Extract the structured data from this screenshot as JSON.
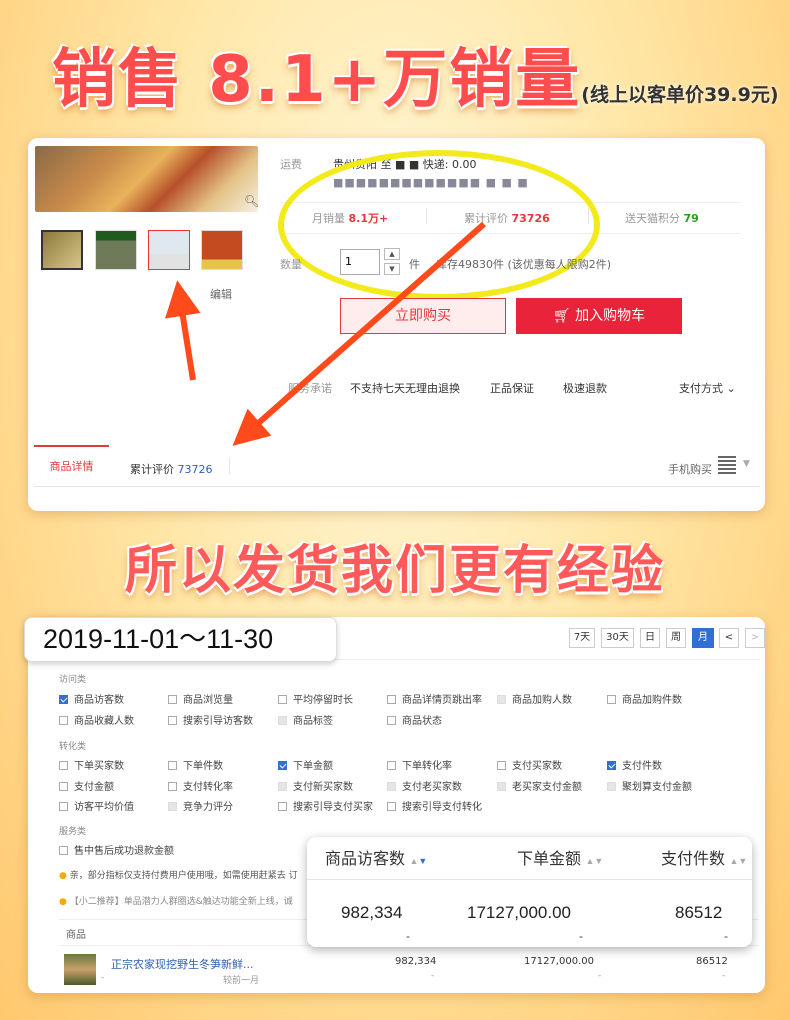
{
  "headline1": {
    "main": "销售 8.1+万销量",
    "sub": "(线上以客单价39.9元)"
  },
  "headline2": "所以发货我们更有经验",
  "product_card": {
    "shipping_label": "运费",
    "shipping_value": "贵州贵阳 至 ■ ■ 快递: 0.00",
    "shipping_blur": "■■■■■■■■■■■■■ ■ ■ ■",
    "monthly_sales_label": "月销量",
    "monthly_sales_value": "8.1万+",
    "total_reviews_label": "累计评价",
    "total_reviews_value": "73726",
    "points_label": "送天猫积分",
    "points_value": "79",
    "quantity_label": "数量",
    "quantity_value": "1",
    "quantity_unit": "件",
    "stock_text": "库存49830件 (该优惠每人限购2件)",
    "edit_label": "编辑",
    "buy_now": "立即购买",
    "add_to_cart": "加入购物车",
    "promise_label": "服务承诺",
    "promises": [
      "不支持七天无理由退换",
      "正品保证",
      "极速退款"
    ],
    "payment_label": "支付方式",
    "tabs": {
      "detail": "商品详情",
      "reviews_label": "累计评价",
      "reviews_value": "73726"
    },
    "mobile_buy": "手机购买"
  },
  "stats_card": {
    "date_range": "2019-11-01～11-30",
    "periods": [
      {
        "label": "7天",
        "active": false
      },
      {
        "label": "30天",
        "active": false
      },
      {
        "label": "日",
        "active": false
      },
      {
        "label": "周",
        "active": false
      },
      {
        "label": "月",
        "active": true
      }
    ],
    "prev": "<",
    "next": ">",
    "sections": {
      "traffic": {
        "title": "访问类",
        "rows": [
          [
            "商品访客数",
            "商品浏览量",
            "平均停留时长",
            "商品详情页跳出率",
            "商品加购人数",
            "商品加购件数"
          ],
          [
            "商品收藏人数",
            "搜索引导访客数",
            "商品标签",
            "商品状态"
          ]
        ]
      },
      "conversion": {
        "title": "转化类",
        "rows": [
          [
            "下单买家数",
            "下单件数",
            "下单金额",
            "下单转化率",
            "支付买家数",
            "支付件数"
          ],
          [
            "支付金额",
            "支付转化率",
            "支付新买家数",
            "支付老买家数",
            "老买家支付金额",
            "聚划算支付金额"
          ],
          [
            "访客平均价值",
            "竞争力评分",
            "搜索引导支付买家",
            "搜索引导支付转化"
          ]
        ]
      },
      "service": {
        "title": "服务类",
        "rows": [
          [
            "售中售后成功退款金额"
          ]
        ]
      }
    },
    "checked": [
      "商品访客数",
      "下单金额",
      "支付件数"
    ],
    "disabled": [
      "商品加购人数",
      "商品标签",
      "支付新买家数",
      "支付老买家数",
      "老买家支付金额",
      "聚划算支付金额",
      "竞争力评分"
    ],
    "notice1": "亲，部分指标仅支持付费用户使用哦，如需使用赶紧去 订",
    "notice2": "【小二推荐】单品潜力人群圈选&触达功能全新上线，诚",
    "table": {
      "header": "商品",
      "product_name": "正宗农家现挖野生冬笋新鲜...",
      "compare": "较前一月",
      "values": [
        "982,334",
        "17127,000.00",
        "86512"
      ],
      "dashes": [
        "-",
        "-",
        "-"
      ]
    },
    "overlay": {
      "headers": [
        "商品访客数",
        "下单金额",
        "支付件数"
      ],
      "values": [
        "982,334",
        "17127,000.00",
        "86512"
      ],
      "dashes": [
        "-",
        "-",
        "-"
      ]
    }
  }
}
